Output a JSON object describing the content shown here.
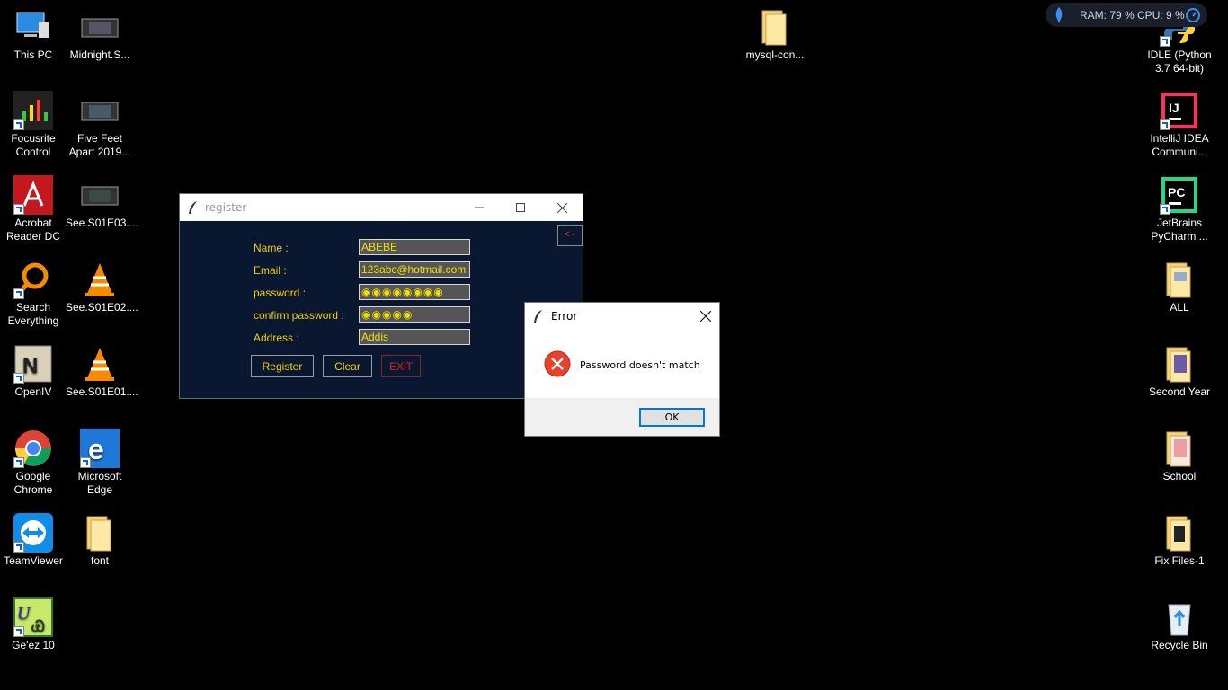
{
  "desktop": {
    "left_col1": [
      {
        "label": "This PC",
        "icon": "this-pc-icon"
      },
      {
        "label": "Focusrite Control",
        "icon": "focusrite-icon"
      },
      {
        "label": "Acrobat Reader DC",
        "icon": "acrobat-icon"
      },
      {
        "label": "Search Everything",
        "icon": "search-everything-icon"
      },
      {
        "label": "OpenIV",
        "icon": "openiv-icon"
      },
      {
        "label": "Google Chrome",
        "icon": "chrome-icon"
      },
      {
        "label": "TeamViewer",
        "icon": "teamviewer-icon"
      },
      {
        "label": "Ge'ez 10",
        "icon": "geez-icon"
      }
    ],
    "left_col2": [
      {
        "label": "Midnight.S...",
        "icon": "video-file-icon"
      },
      {
        "label": "Five Feet Apart 2019...",
        "icon": "video-file-icon"
      },
      {
        "label": "See.S01E03....",
        "icon": "video-file-icon"
      },
      {
        "label": "See.S01E02....",
        "icon": "vlc-icon"
      },
      {
        "label": "See.S01E01....",
        "icon": "vlc-icon"
      },
      {
        "label": "Microsoft Edge",
        "icon": "edge-icon"
      },
      {
        "label": "font",
        "icon": "folder-icon"
      }
    ],
    "center": [
      {
        "label": "mysql-con...",
        "icon": "folder-icon"
      }
    ],
    "right_col": [
      {
        "label": "IDLE (Python 3.7 64-bit)",
        "icon": "python-idle-icon"
      },
      {
        "label": "IntelliJ IDEA Communi...",
        "icon": "intellij-icon"
      },
      {
        "label": "JetBrains PyCharm ...",
        "icon": "pycharm-icon"
      },
      {
        "label": "ALL",
        "icon": "folder-icon"
      },
      {
        "label": "Second Year",
        "icon": "folder-icon"
      },
      {
        "label": "School",
        "icon": "folder-icon"
      },
      {
        "label": "Fix Files-1",
        "icon": "folder-icon"
      },
      {
        "label": "Recycle Bin",
        "icon": "recycle-bin-icon"
      }
    ]
  },
  "meter": {
    "text": "RAM: 79 %  CPU: 9 %"
  },
  "register": {
    "title": "register",
    "back_label": "<-",
    "fields": [
      {
        "label": "Name :",
        "value": "ABEBE"
      },
      {
        "label": "Email :",
        "value": "123abc@hotmail.com"
      },
      {
        "label": "password :",
        "value": "◉◉◉◉◉◉◉◉"
      },
      {
        "label": "confirm password :",
        "value": "◉◉◉◉◉"
      },
      {
        "label": "Address :",
        "value": "Addis"
      }
    ],
    "buttons": {
      "register": "Register",
      "clear": "Clear",
      "exit": "EXiT"
    }
  },
  "error_dialog": {
    "title": "Error",
    "message": "Password doesn't match",
    "ok": "OK"
  },
  "colors": {
    "form_bg": "#0a1730",
    "label_yellow": "#f0d000",
    "exit_red": "#e02020",
    "error_red": "#e8412c",
    "ok_blue": "#0078d7"
  }
}
